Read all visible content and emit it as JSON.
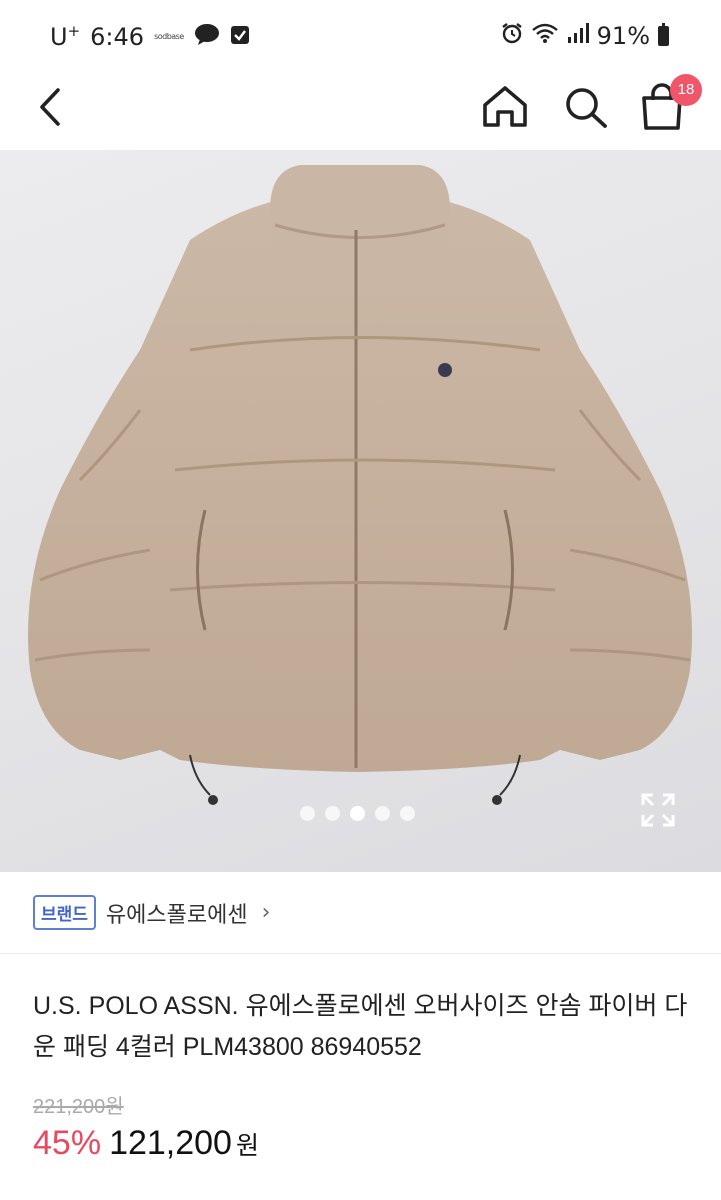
{
  "status_bar": {
    "carrier": "U",
    "carrier_sup": "+",
    "time": "6:46",
    "mini_logo": "sodbase",
    "battery_percent": "91%"
  },
  "header": {
    "cart_badge": "18",
    "icons": [
      "back-arrow-icon",
      "home-icon",
      "search-icon",
      "shopping-bag-icon"
    ]
  },
  "gallery": {
    "image_subject": "beige puffer jacket",
    "slide_count": 5,
    "active_slide": 3
  },
  "brand": {
    "badge": "브랜드",
    "name": "유에스폴로에센",
    "chevron": "›"
  },
  "product": {
    "title": "U.S. POLO ASSN. 유에스폴로에센 오버사이즈 안솜 파이버 다운 패딩 4컬러 PLM43800 86940552",
    "original_price": "221,200원",
    "discount": "45%",
    "price": "121,200",
    "currency": "원"
  },
  "colors": {
    "accent": "#e74a5e",
    "badge": "#f0566a",
    "brand_blue": "#4266c8"
  }
}
